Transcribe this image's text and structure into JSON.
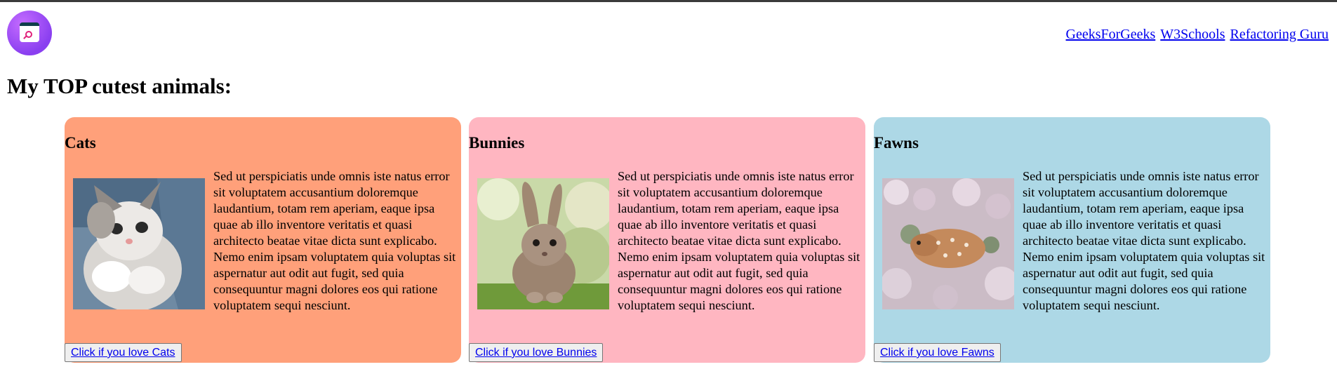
{
  "header": {
    "logo": "app-logo-magnifier-icon",
    "links": [
      "GeeksForGeeks",
      "W3Schools",
      "Refactoring Guru"
    ]
  },
  "page": {
    "title": "My TOP cutest animals:"
  },
  "cards": [
    {
      "title": "Cats",
      "bg": "#ffa07a",
      "image": "kitten-photo",
      "text": "Sed ut perspiciatis unde omnis iste natus error sit voluptatem accusantium doloremque laudantium, totam rem aperiam, eaque ipsa quae ab illo inventore veritatis et quasi architecto beatae vitae dicta sunt explicabo. Nemo enim ipsam voluptatem quia voluptas sit aspernatur aut odit aut fugit, sed quia consequuntur magni dolores eos qui ratione voluptatem sequi nesciunt.",
      "button": "Click if you love Cats"
    },
    {
      "title": "Bunnies",
      "bg": "#ffb6c1",
      "image": "bunny-photo",
      "text": "Sed ut perspiciatis unde omnis iste natus error sit voluptatem accusantium doloremque laudantium, totam rem aperiam, eaque ipsa quae ab illo inventore veritatis et quasi architecto beatae vitae dicta sunt explicabo. Nemo enim ipsam voluptatem quia voluptas sit aspernatur aut odit aut fugit, sed quia consequuntur magni dolores eos qui ratione voluptatem sequi nesciunt.",
      "button": "Click if you love Bunnies"
    },
    {
      "title": "Fawns",
      "bg": "#add8e6",
      "image": "fawn-photo",
      "text": "Sed ut perspiciatis unde omnis iste natus error sit voluptatem accusantium doloremque laudantium, totam rem aperiam, eaque ipsa quae ab illo inventore veritatis et quasi architecto beatae vitae dicta sunt explicabo. Nemo enim ipsam voluptatem quia voluptas sit aspernatur aut odit aut fugit, sed quia consequuntur magni dolores eos qui ratione voluptatem sequi nesciunt.",
      "button": "Click if you love Fawns"
    }
  ]
}
